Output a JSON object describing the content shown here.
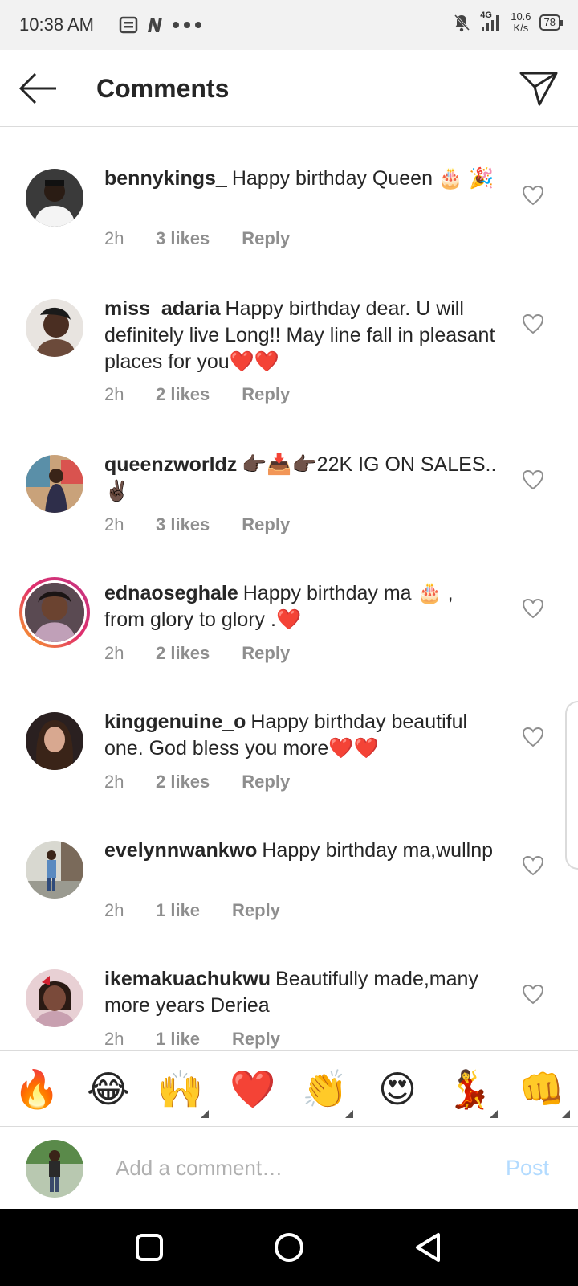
{
  "status": {
    "time": "10:38 AM",
    "network": "4G",
    "speed_value": "10.6",
    "speed_unit": "K/s",
    "battery": "78"
  },
  "header": {
    "title": "Comments"
  },
  "comments": [
    {
      "username": "bennykings_",
      "text": "Happy birthday Queen 🎂 🎉",
      "time": "2h",
      "likes": "3 likes",
      "reply": "Reply"
    },
    {
      "username": "miss_adaria",
      "text": "Happy birthday dear. U will definitely live Long!! May line fall in pleasant places for you❤️❤️",
      "time": "2h",
      "likes": "2 likes",
      "reply": "Reply"
    },
    {
      "username": "queenzworldz",
      "text": "👉🏿📥👉🏿22K IG ON SALES..✌🏿",
      "time": "2h",
      "likes": "3 likes",
      "reply": "Reply"
    },
    {
      "username": "ednaoseghale",
      "text": "Happy birthday ma 🎂 , from glory to glory .❤️",
      "time": "2h",
      "likes": "2 likes",
      "reply": "Reply"
    },
    {
      "username": "kinggenuine_o",
      "text": "Happy birthday beautiful one. God bless you more❤️❤️",
      "time": "2h",
      "likes": "2 likes",
      "reply": "Reply"
    },
    {
      "username": "evelynnwankwo",
      "text": "Happy birthday ma,wullnp",
      "time": "2h",
      "likes": "1 like",
      "reply": "Reply"
    },
    {
      "username": "ikemakuachukwu",
      "text": "Beautifully made,many more years Deriea",
      "time": "2h",
      "likes": "1 like",
      "reply": "Reply"
    }
  ],
  "emoji_bar": [
    "🔥",
    "😂",
    "🙌",
    "❤️",
    "👏",
    "😍",
    "💃",
    "👊"
  ],
  "composer": {
    "placeholder": "Add a comment…",
    "post_label": "Post"
  },
  "colors": {
    "accent_disabled": "#b3dbff",
    "secondary_text": "#8e8e8e",
    "heart_red": "#e0245e"
  },
  "icons": {
    "back": "arrow-left-icon",
    "send": "paper-plane-icon",
    "like": "heart-outline-icon",
    "nav_recents": "square-icon",
    "nav_home": "circle-icon",
    "nav_back": "triangle-back-icon"
  }
}
